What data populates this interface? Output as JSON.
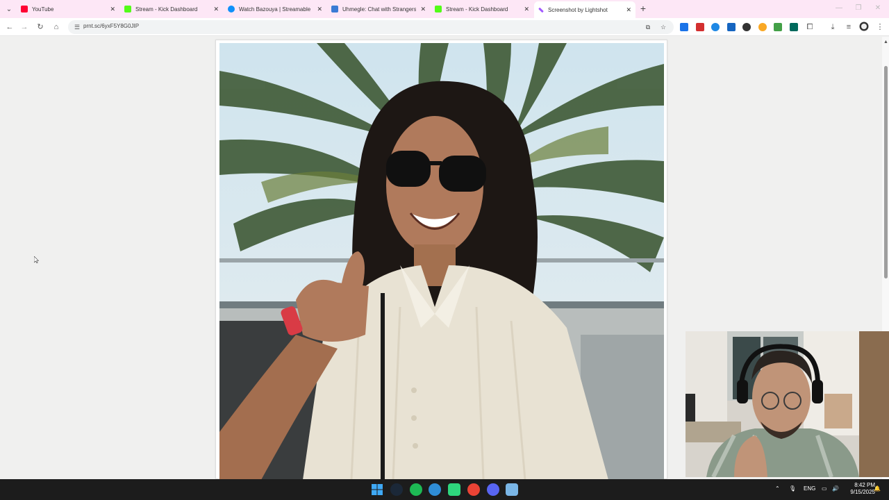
{
  "tabs": [
    {
      "title": "YouTube",
      "favicon": "youtube-favicon",
      "color": "#ff0033"
    },
    {
      "title": "Stream - Kick Dashboard",
      "favicon": "kick-favicon",
      "color": "#53fc18"
    },
    {
      "title": "Watch Bazouya | Streamable",
      "favicon": "streamable-favicon",
      "color": "#0f90fa"
    },
    {
      "title": "Uhmegle: Chat with Strangers!",
      "favicon": "uhmegle-favicon",
      "color": "#3a7bd5"
    },
    {
      "title": "Stream - Kick Dashboard",
      "favicon": "kick-favicon",
      "color": "#53fc18"
    },
    {
      "title": "Screenshot by Lightshot",
      "favicon": "lightshot-favicon",
      "color": "#a259ff"
    }
  ],
  "address_bar": {
    "url": "prnt.sc/6yxF5Y8G0JIP"
  },
  "toolbar_icons": [
    "back-icon",
    "forward-icon",
    "reload-icon",
    "home-icon",
    "site-info-icon",
    "install-icon",
    "star-icon",
    "downloads-icon",
    "media-icon",
    "profile-icon",
    "menu-icon"
  ],
  "extension_colors": [
    "#1a73e8",
    "#d32f2f",
    "#1e88e5",
    "#1565c0",
    "#333333",
    "#f9a825",
    "#43a047",
    "#00695c",
    "#555555"
  ],
  "taskbar": {
    "apps": [
      {
        "name": "windows-start-icon",
        "color": "#2b88ff"
      },
      {
        "name": "steam-icon",
        "color": "#1b2838"
      },
      {
        "name": "spotify-icon",
        "color": "#1db954"
      },
      {
        "name": "edge-icon",
        "color": "#2f8dd6"
      },
      {
        "name": "obs-icon",
        "color": "#2ed67d"
      },
      {
        "name": "chrome-icon",
        "color": "#ea4335"
      },
      {
        "name": "discord-icon",
        "color": "#5865f2"
      },
      {
        "name": "notepad-icon",
        "color": "#7ab6e6"
      }
    ],
    "language": "ENG",
    "time": "8:42 PM",
    "date": "9/15/2025"
  }
}
